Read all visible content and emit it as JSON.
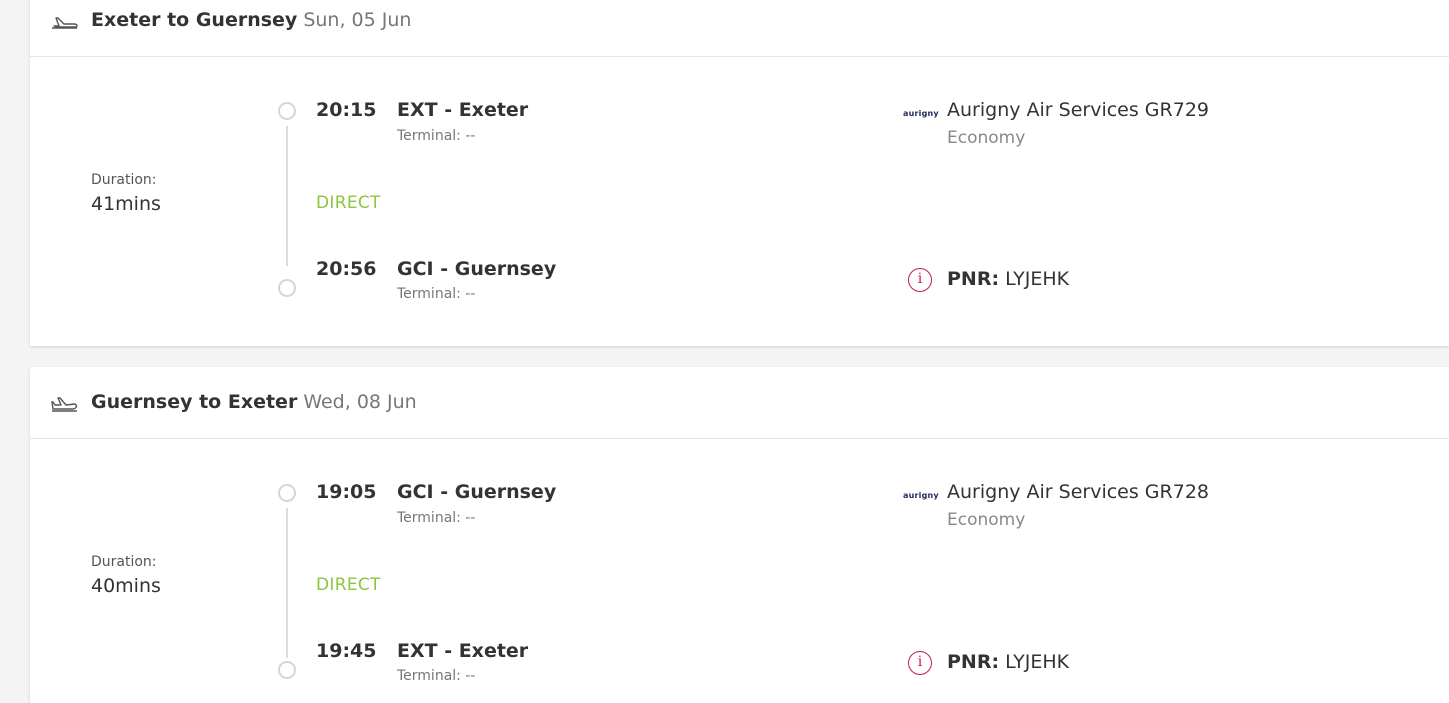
{
  "segments": [
    {
      "route": "Exeter to Guernsey",
      "date": "Sun, 05 Jun",
      "duration_label": "Duration:",
      "duration": "41mins",
      "departure": {
        "time": "20:15",
        "airport": "EXT - Exeter",
        "terminal": "Terminal: --"
      },
      "stop_label": "DIRECT",
      "arrival": {
        "time": "20:56",
        "airport": "GCI - Guernsey",
        "terminal": "Terminal: --"
      },
      "airline_logo": "aurigny",
      "airline": "Aurigny Air Services GR729",
      "cabin": "Economy",
      "pnr_label": "PNR:",
      "pnr": "LYJEHK",
      "icon": "plane-takeoff-icon"
    },
    {
      "route": "Guernsey to Exeter",
      "date": "Wed, 08 Jun",
      "duration_label": "Duration:",
      "duration": "40mins",
      "departure": {
        "time": "19:05",
        "airport": "GCI - Guernsey",
        "terminal": "Terminal: --"
      },
      "stop_label": "DIRECT",
      "arrival": {
        "time": "19:45",
        "airport": "EXT - Exeter",
        "terminal": "Terminal: --"
      },
      "airline_logo": "aurigny",
      "airline": "Aurigny Air Services GR728",
      "cabin": "Economy",
      "pnr_label": "PNR:",
      "pnr": "LYJEHK",
      "icon": "plane-landing-icon"
    }
  ],
  "colors": {
    "direct": "#8cc63f",
    "info": "#c2185b",
    "logo": "#1f2a5c"
  }
}
